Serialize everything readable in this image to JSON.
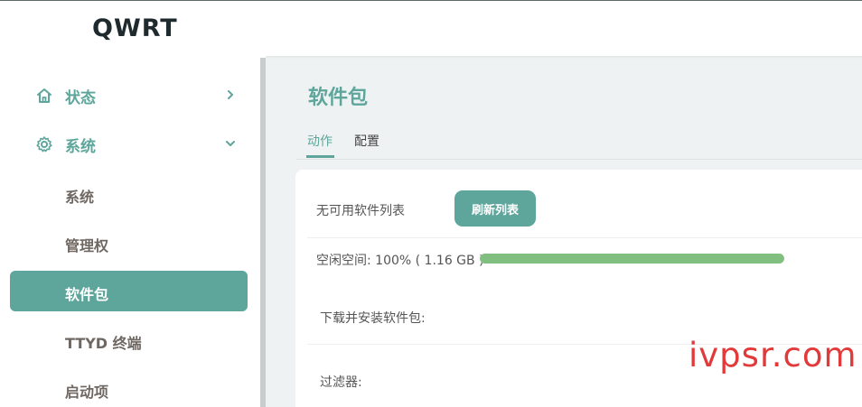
{
  "app": {
    "brand": "QWRT"
  },
  "sidebar": {
    "groups": [
      {
        "label": "状态",
        "icon": "home-icon",
        "chevron": "chevron-right-icon"
      },
      {
        "label": "系统",
        "icon": "gear-icon",
        "chevron": "chevron-down-icon"
      }
    ],
    "sub_items": [
      {
        "label": "系统"
      },
      {
        "label": "管理权"
      },
      {
        "label": "软件包",
        "active": true
      },
      {
        "label": "TTYD 终端"
      },
      {
        "label": "启动项"
      }
    ]
  },
  "main": {
    "title": "软件包",
    "tabs": [
      {
        "label": "动作",
        "active": true
      },
      {
        "label": "配置",
        "active": false
      }
    ],
    "no_list_label": "无可用软件列表",
    "refresh_button": "刷新列表",
    "free_space_label": "空闲空间: 100% ( 1.16 GB )",
    "free_space_fraction": 1.0,
    "download_install_label": "下载并安装软件包:",
    "filter_label": "过滤器:"
  },
  "watermark": "ivpsr.com",
  "colors": {
    "accent": "#5ea69b",
    "progress": "#80bf7f",
    "watermark": "#e23a3a"
  }
}
